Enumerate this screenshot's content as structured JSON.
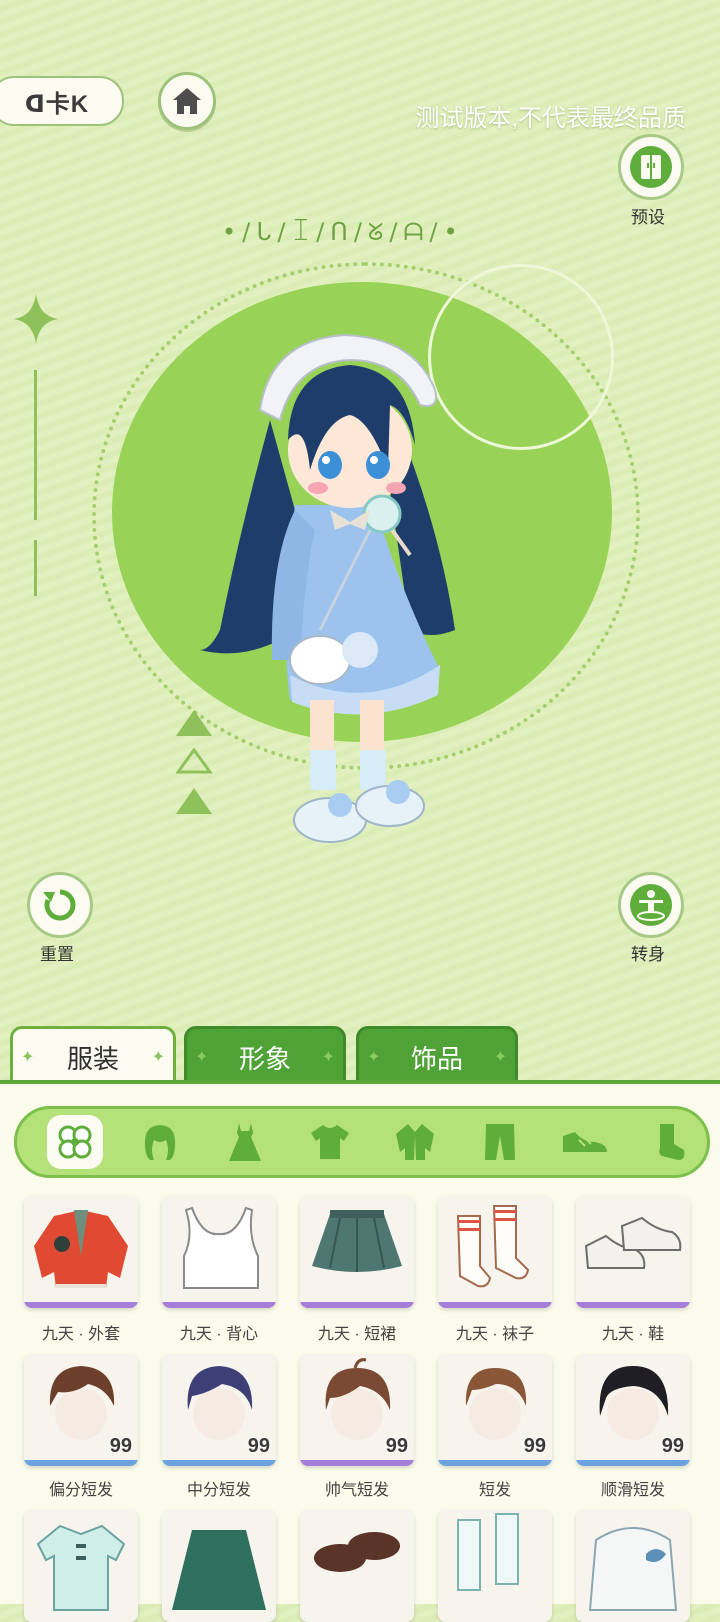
{
  "top": {
    "logo_text": "ᗡ卡K",
    "home_icon": "home-icon",
    "beta_notice": "测试版本,不代表最终品质",
    "deco_letters": "•/ᒐ/ꀤ/ᑎ/ᘜ/ᗩ/•"
  },
  "side": {
    "preset_label": "预设",
    "reset_label": "重置",
    "turn_label": "转身"
  },
  "tabs": [
    {
      "label": "服装",
      "active": true
    },
    {
      "label": "形象",
      "active": false
    },
    {
      "label": "饰品",
      "active": false
    }
  ],
  "categories": [
    "flower-icon",
    "hair-icon",
    "dress-icon",
    "tshirt-icon",
    "jacket-icon",
    "pants-icon",
    "shoe-icon",
    "sock-icon"
  ],
  "items_row1": [
    {
      "label": "九天 · 外套",
      "bar": "#a57ed8"
    },
    {
      "label": "九天 · 背心",
      "bar": "#a57ed8"
    },
    {
      "label": "九天 · 短裙",
      "bar": "#a57ed8"
    },
    {
      "label": "九天 · 袜子",
      "bar": "#a57ed8"
    },
    {
      "label": "九天 · 鞋",
      "bar": "#a57ed8"
    }
  ],
  "items_row2": [
    {
      "label": "偏分短发",
      "count": "99",
      "bar": "#6aa3e0"
    },
    {
      "label": "中分短发",
      "count": "99",
      "bar": "#6aa3e0"
    },
    {
      "label": "帅气短发",
      "count": "99",
      "bar": "#a57ed8"
    },
    {
      "label": "短发",
      "count": "99",
      "bar": "#6aa3e0"
    },
    {
      "label": "顺滑短发",
      "count": "99",
      "bar": "#6aa3e0"
    }
  ],
  "colors": {
    "accent_green": "#4fa336",
    "panel": "#fbfbeb",
    "circle": "#98d357"
  }
}
